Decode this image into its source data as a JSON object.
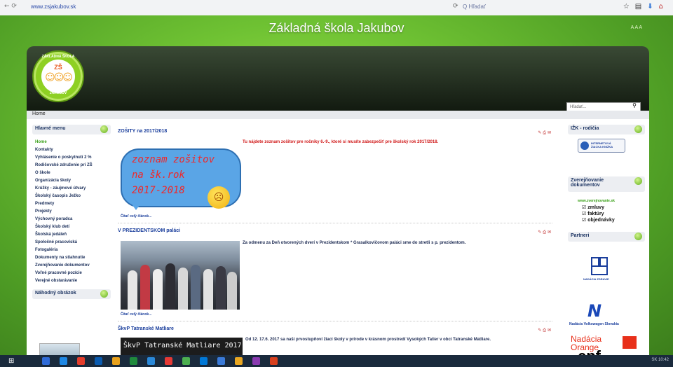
{
  "browser": {
    "nav_arrows": "← ⟳",
    "url": "www.zsjakubov.sk",
    "reload_icon": "⟳",
    "search_placeholder": "Q Hľadať",
    "icons": [
      "star-icon",
      "library-icon",
      "pocket-icon",
      "home-icon"
    ]
  },
  "site": {
    "title": "Základná škola Jakubov",
    "lang_links": "A A A",
    "logo_top": "ZÁKLADNÁ ŠKOLA",
    "logo_center": "ZŠ",
    "logo_bottom": "JAKUBOV",
    "search_placeholder": "Hľadať...",
    "search_icon": "⚲"
  },
  "breadcrumb": "Home",
  "left_menu": {
    "title": "Hlavné menu",
    "items": [
      "Home",
      "Kontakty",
      "Vyhlásenie o poskytnutí 2 %",
      "Rodičovské združenie pri ZŠ",
      "O škole",
      "Organizácia školy",
      "Krúžky - záujmové útvary",
      "Školský časopis Ježko",
      "Predmety",
      "Projekty",
      "Výchovný poradca",
      "Školský klub detí",
      "Školská jedáleň",
      "Spoločné pracoviská",
      "Fotogaléria",
      "Dokumenty na stiahnutie",
      "Zverejňovanie dokumentov",
      "Voľné pracovné pozície",
      "Verejné obstarávanie"
    ],
    "random_title": "Náhodný obrázok"
  },
  "articles": [
    {
      "title": "ZOŠITY na 2017/2018",
      "notice": "Tu nájdete zoznam zošitov pre ročníky 6.-9., ktoré si musíte zabezpečiť pre školský rok 2017/2018.",
      "image_lines": [
        "zoznam zošitov",
        "na šk.rok",
        "2017-2018"
      ],
      "image_emoji": "☹",
      "read_more": "Čítať celý článok...",
      "icons": "✎ ⎙ ✉"
    },
    {
      "title": "V PREZIDENTSKOM paláci",
      "text": "Za odmenu za Deň otvorených dverí v Prezidentskom * Grasalkovičovom paláci sme do stretli s p. prezidentom.",
      "read_more": "Čítať celý článok...",
      "icons": "✎ ⎙ ✉"
    },
    {
      "title": "ŠkvP Tatranské Matliare",
      "text": "Od 12. 17.6. 2017 sa naši prvostupňoví žiaci školy v prírode v krásnom prostredí Vysokých Tatier v obci Tatranské Matliare.",
      "image_caption": "ŠkvP Tatranské Matliare 2017",
      "icons": "✎ ⎙ ✉"
    }
  ],
  "right_col": {
    "ipzk_title": "IŽK - rodičia",
    "ipzk_button": [
      "INTERNETOVÁ",
      "ŽIACKA KNIŽKA"
    ],
    "docs_title": "Zverejňovanie dokumentov",
    "docs_link": "www.zverejnovanie.sk",
    "docs_items": [
      "zmluvy",
      "faktúry",
      "objednávky"
    ],
    "partners_title": "Partneri",
    "partner_small": "NADÁCIA ZDRAVIE",
    "vw_text": "Nadácia Volkswagen Slovakia",
    "orange_text": [
      "Nadácia",
      "Orange"
    ],
    "cpf_text": "cpf"
  },
  "taskbar": {
    "tray": "SK 10:42",
    "colors": [
      "#2f6bd8",
      "#1e88e5",
      "#e43d2b",
      "#0a5bb0",
      "#e8a11c",
      "#1f8a3c",
      "#2a88d8",
      "#e53935",
      "#4caf50",
      "#0078d7",
      "#3a7ad8",
      "#e9a722",
      "#8a3ab0",
      "#d8401e"
    ]
  }
}
